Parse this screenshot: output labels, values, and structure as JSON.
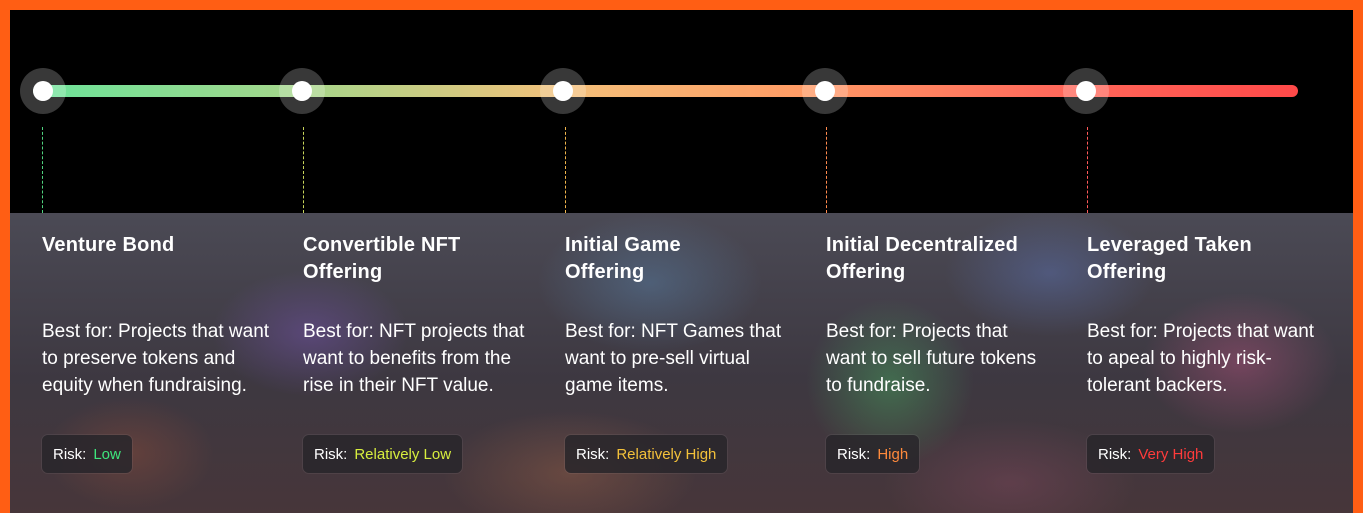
{
  "risk_label": "Risk:",
  "offerings": [
    {
      "title": "Venture Bond",
      "description": "Best for: Projects that want to preserve tokens and equity when fundraising.",
      "risk": "Low",
      "risk_color": "#3ee67c",
      "dash_color": "#4fd37f"
    },
    {
      "title": "Convertible NFT Offering",
      "description": "Best for: NFT projects that want to benefits from the rise in their NFT value.",
      "risk": "Relatively Low",
      "risk_color": "#d7ee3e",
      "dash_color": "#c7d35a"
    },
    {
      "title": "Initial Game Offering",
      "description": "Best for: NFT Games that want to pre-sell virtual game items.",
      "risk": "Relatively High",
      "risk_color": "#f3c13a",
      "dash_color": "#f0b54c"
    },
    {
      "title": "Initial Decentralized Offering",
      "description": "Best for: Projects that want to sell future tokens to fundraise.",
      "risk": "High",
      "risk_color": "#ff8a3c",
      "dash_color": "#ff8a4e"
    },
    {
      "title": "Leveraged Taken Offering",
      "description": "Best for: Projects that want to apeal to highly risk-tolerant backers.",
      "risk": "Very High",
      "risk_color": "#ff3b3b",
      "dash_color": "#ff5a5a"
    }
  ]
}
